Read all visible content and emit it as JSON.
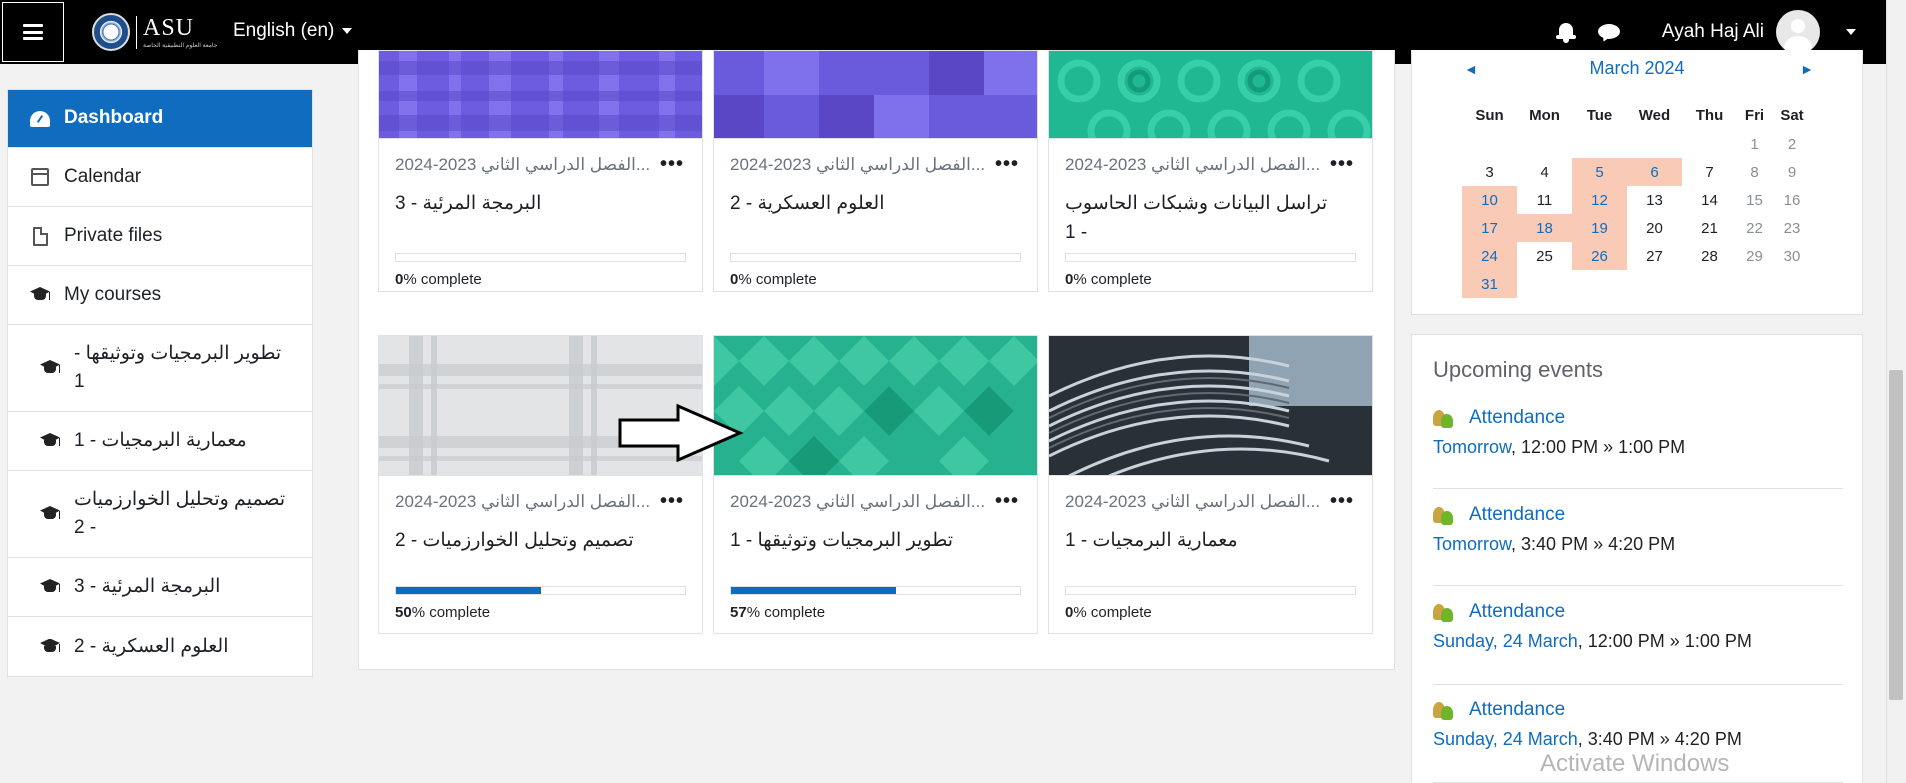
{
  "navbar": {
    "logo_text": "ASU",
    "logo_subtext": "جامعة العلوم التطبيقية الخاصة",
    "language": "English (en)",
    "username": "Ayah Haj Ali"
  },
  "sidebar": {
    "items": [
      {
        "label": "Dashboard",
        "icon": "dashboard-icon"
      },
      {
        "label": "Calendar",
        "icon": "calendar-icon"
      },
      {
        "label": "Private files",
        "icon": "file-icon"
      },
      {
        "label": "My courses",
        "icon": "graduation-cap-icon"
      },
      {
        "label": "تطوير البرمجيات وتوثيقها - 1",
        "icon": "graduation-cap-icon"
      },
      {
        "label": "معمارية البرمجيات - 1",
        "icon": "graduation-cap-icon"
      },
      {
        "label": "تصميم وتحليل الخوارزميات - 2",
        "icon": "graduation-cap-icon"
      },
      {
        "label": "البرمجة المرئية - 3",
        "icon": "graduation-cap-icon"
      },
      {
        "label": "العلوم العسكرية - 2",
        "icon": "graduation-cap-icon"
      }
    ]
  },
  "courses": {
    "menu_glyph": "•••",
    "complete_suffix": "% complete",
    "cards": [
      {
        "category": "2024-2023 الفصل الدراسي الثاني...",
        "name": "البرمجة المرئية - 3",
        "progress": "0",
        "pattern": "purple-plaid"
      },
      {
        "category": "2024-2023 الفصل الدراسي الثاني...",
        "name": "العلوم العسكرية - 2",
        "progress": "0",
        "pattern": "purple-squares"
      },
      {
        "category": "2024-2023 الفصل الدراسي الثاني...",
        "name": "تراسل البيانات وشبكات الحاسوب - 1",
        "progress": "0",
        "pattern": "teal-circles"
      },
      {
        "category": "2024-2023 الفصل الدراسي الثاني...",
        "name": "تصميم وتحليل الخوارزميات - 2",
        "progress": "50",
        "pattern": "grey-plaid"
      },
      {
        "category": "2024-2023 الفصل الدراسي الثاني...",
        "name": "تطوير البرمجيات وتوثيقها - 1",
        "progress": "57",
        "pattern": "teal-diamonds"
      },
      {
        "category": "2024-2023 الفصل الدراسي الثاني...",
        "name": "معمارية البرمجيات - 1",
        "progress": "0",
        "pattern": "architecture-photo"
      }
    ]
  },
  "calendar": {
    "month": "March 2024",
    "prev": "◄",
    "next": "►",
    "weekdays": [
      "Sun",
      "Mon",
      "Tue",
      "Wed",
      "Thu",
      "Fri",
      "Sat"
    ],
    "weeks": [
      [
        "",
        "",
        "",
        "",
        "",
        "1",
        "2"
      ],
      [
        "3",
        "4",
        "5",
        "6",
        "7",
        "8",
        "9"
      ],
      [
        "10",
        "11",
        "12",
        "13",
        "14",
        "15",
        "16"
      ],
      [
        "17",
        "18",
        "19",
        "20",
        "21",
        "22",
        "23"
      ],
      [
        "24",
        "25",
        "26",
        "27",
        "28",
        "29",
        "30"
      ],
      [
        "31",
        "",
        "",
        "",
        "",
        "",
        ""
      ]
    ],
    "highlighted_days": [
      "5",
      "6",
      "10",
      "12",
      "17",
      "18",
      "19",
      "24",
      "26",
      "31"
    ],
    "weekend_days": [
      "1",
      "2",
      "8",
      "9",
      "15",
      "16",
      "22",
      "23",
      "29",
      "30"
    ],
    "highlight_color": "#f9cbb6"
  },
  "events": {
    "title": "Upcoming events",
    "items": [
      {
        "name": "Attendance",
        "day": "Tomorrow",
        "time": ", 12:00 PM » 1:00 PM"
      },
      {
        "name": "Attendance",
        "day": "Tomorrow",
        "time": ", 3:40 PM » 4:20 PM"
      },
      {
        "name": "Attendance",
        "day": "Sunday, 24 March",
        "time": ", 12:00 PM » 1:00 PM"
      },
      {
        "name": "Attendance",
        "day": "Sunday, 24 March",
        "time": ", 3:40 PM » 4:20 PM"
      }
    ]
  },
  "watermark": "Activate Windows",
  "colors": {
    "primary": "#0f6cbf",
    "navbar": "#000000"
  }
}
